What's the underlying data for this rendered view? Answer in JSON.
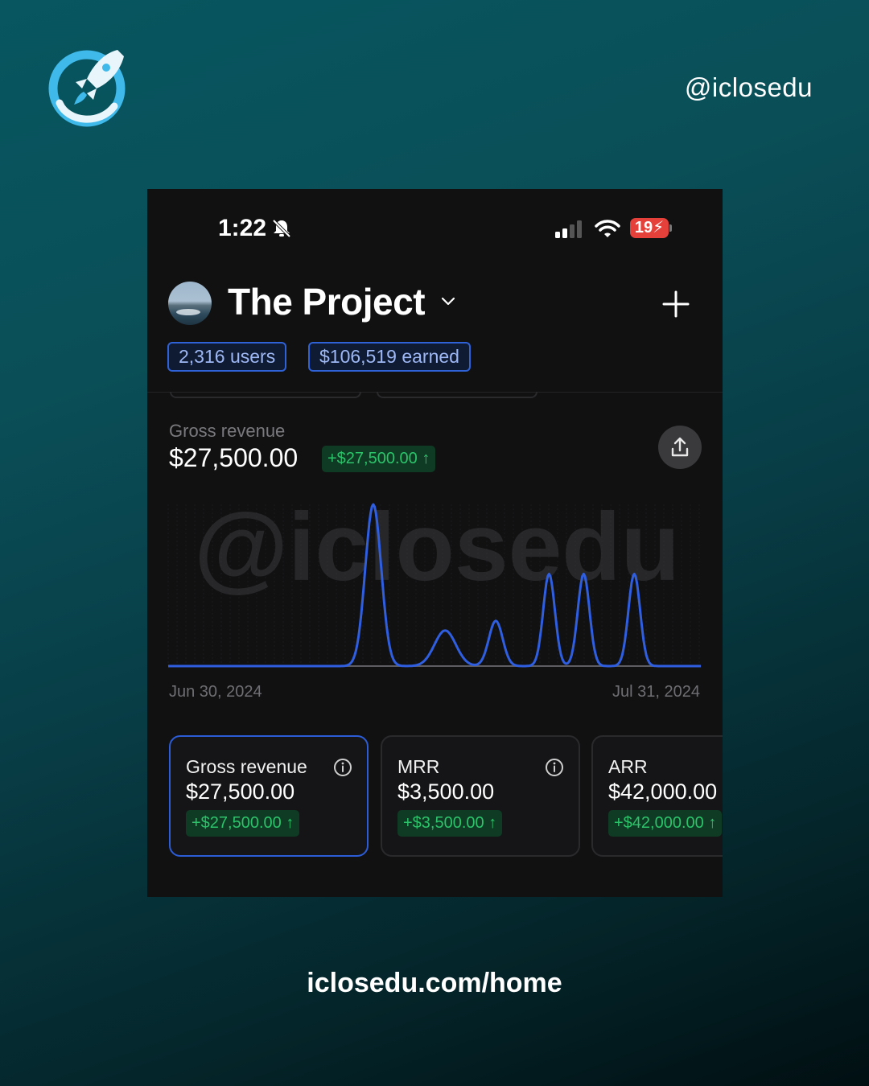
{
  "brand": {
    "handle": "@iclosedu",
    "url": "iclosedu.com/home",
    "logo_icon": "rocket-logo-icon",
    "watermark": "@iclosedu"
  },
  "status_bar": {
    "time": "1:22",
    "battery": "19"
  },
  "header": {
    "project_title": "The Project",
    "users_pill": "2,316 users",
    "earned_pill": "$106,519 earned"
  },
  "summary": {
    "label": "Gross revenue",
    "value": "$27,500.00",
    "delta": "+$27,500.00 ↑"
  },
  "chart_data": {
    "type": "line",
    "x_start_label": "Jun 30, 2024",
    "x_end_label": "Jul 31, 2024",
    "series_color": "#2f5fe0",
    "peaks": [
      {
        "center": 0.385,
        "height": 1.0,
        "width": 0.015
      },
      {
        "center": 0.52,
        "height": 0.22,
        "width": 0.02
      },
      {
        "center": 0.615,
        "height": 0.28,
        "width": 0.013
      },
      {
        "center": 0.715,
        "height": 0.57,
        "width": 0.011
      },
      {
        "center": 0.78,
        "height": 0.57,
        "width": 0.011
      },
      {
        "center": 0.875,
        "height": 0.57,
        "width": 0.011
      }
    ]
  },
  "cards": [
    {
      "title": "Gross revenue",
      "value": "$27,500.00",
      "delta": "+$27,500.00 ↑"
    },
    {
      "title": "MRR",
      "value": "$3,500.00",
      "delta": "+$3,500.00 ↑"
    },
    {
      "title": "ARR",
      "value": "$42,000.00",
      "delta": "+$42,000.00 ↑"
    }
  ]
}
